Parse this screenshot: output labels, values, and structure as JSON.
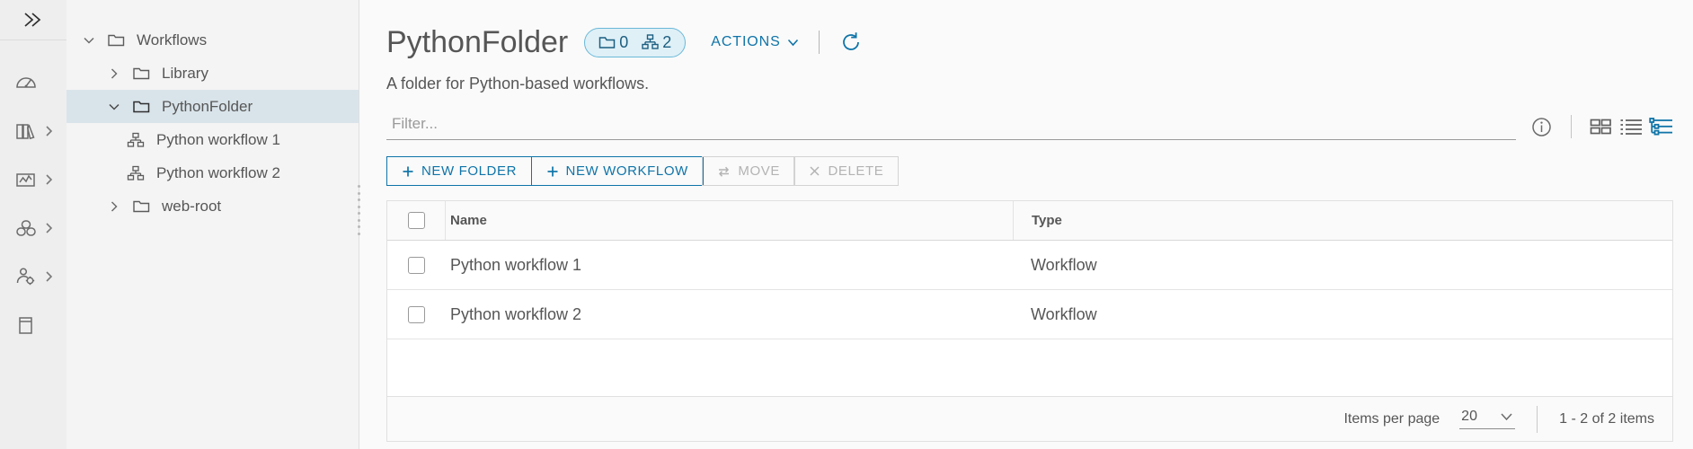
{
  "rail": {
    "expand_label": "expand-navigation",
    "items": [
      {
        "icon": "gauge-icon",
        "name": "dashboard",
        "has_chevron": false
      },
      {
        "icon": "library-books-icon",
        "name": "library",
        "has_chevron": true
      },
      {
        "icon": "analytics-chart-icon",
        "name": "analytics",
        "has_chevron": true
      },
      {
        "icon": "cubes-resources-icon",
        "name": "resources",
        "has_chevron": true
      },
      {
        "icon": "user-settings-icon",
        "name": "administration",
        "has_chevron": true
      },
      {
        "icon": "archive-box-icon",
        "name": "archive",
        "has_chevron": false
      }
    ]
  },
  "tree": {
    "nodes": [
      {
        "label": "Workflows",
        "icon": "folder-icon",
        "level": 0,
        "twisty": "down",
        "selected": false
      },
      {
        "label": "Library",
        "icon": "folder-icon",
        "level": 1,
        "twisty": "right",
        "selected": false
      },
      {
        "label": "PythonFolder",
        "icon": "folder-icon",
        "level": 1,
        "twisty": "down",
        "selected": true
      },
      {
        "label": "Python workflow 1",
        "icon": "workflow-icon",
        "level": 2,
        "twisty": "none",
        "selected": false
      },
      {
        "label": "Python workflow 2",
        "icon": "workflow-icon",
        "level": 2,
        "twisty": "none",
        "selected": false
      },
      {
        "label": "web-root",
        "icon": "folder-icon",
        "level": 1,
        "twisty": "right",
        "selected": false
      }
    ]
  },
  "header": {
    "title": "PythonFolder",
    "badge": {
      "folder_icon": "folder-icon",
      "folder_count": "0",
      "workflow_icon": "workflow-icon",
      "workflow_count": "2"
    },
    "actions_label": "ACTIONS",
    "actions_chevron": "chevron-down-icon",
    "refresh_icon": "refresh-icon",
    "subtitle": "A folder for Python-based workflows."
  },
  "filter": {
    "placeholder": "Filter...",
    "value": "",
    "info_icon": "info-circle-icon",
    "views": [
      {
        "name": "card-view-icon",
        "active": false
      },
      {
        "name": "list-view-icon",
        "active": false
      },
      {
        "name": "tree-view-icon",
        "active": true
      }
    ]
  },
  "toolbar": {
    "new_folder_label": "NEW FOLDER",
    "new_workflow_label": "NEW WORKFLOW",
    "move_label": "MOVE",
    "delete_label": "DELETE",
    "plus_icon": "plus-icon",
    "move_icon": "swap-arrows-icon",
    "delete_icon": "close-x-icon"
  },
  "table": {
    "columns": [
      "Name",
      "Type"
    ],
    "rows": [
      {
        "name": "Python workflow 1",
        "type": "Workflow"
      },
      {
        "name": "Python workflow 2",
        "type": "Workflow"
      }
    ]
  },
  "pagination": {
    "items_per_page_label": "Items per page",
    "items_per_page_value": "20",
    "chevron": "chevron-down-icon",
    "range_label": "1 - 2 of 2 items"
  },
  "colors": {
    "accent_blue": "#0f74a8",
    "badge_bg": "#dff0f7",
    "badge_border": "#6ab8d8",
    "selected_row": "#d9e4ea",
    "rail_bg": "#eeeeee",
    "tree_bg": "#f4f4f4"
  }
}
